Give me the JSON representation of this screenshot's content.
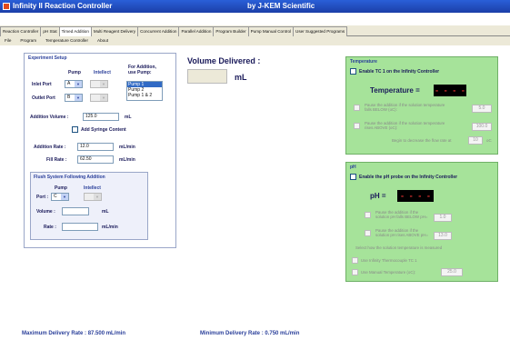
{
  "window": {
    "title": "Infinity II Reaction Controller",
    "vendor": "by J-KEM Scientific"
  },
  "tabs": [
    {
      "label": "Reaction Controller"
    },
    {
      "label": "pH Stat"
    },
    {
      "label": "Timed Addition"
    },
    {
      "label": "Multi Reagent Delivery"
    },
    {
      "label": "Concurrent Addition"
    },
    {
      "label": "Parallel Addition"
    },
    {
      "label": "Program Builder"
    },
    {
      "label": "Pump Manual Control"
    },
    {
      "label": "User Suggested Programs"
    }
  ],
  "active_tab": "Timed Addition",
  "menu": [
    "File",
    "Program",
    "Temperature Controller",
    "About"
  ],
  "experiment": {
    "title": "Experiment Setup",
    "col_pump": "Pump",
    "col_intellect": "Intellect",
    "for_addition_label": "For Addition,\nuse Pump:",
    "inlet_label": "Inlet Port",
    "inlet_value": "A",
    "outlet_label": "Outlet Port",
    "outlet_value": "B",
    "pump_options": [
      "Pump 1",
      "Pump 2",
      "Pump 1 & 2"
    ],
    "addition_volume_label": "Addition Volume :",
    "addition_volume_value": "125.0",
    "addition_volume_unit": "mL",
    "syringe_content_label": "Add Syringe Content",
    "addition_rate_label": "Addition Rate :",
    "addition_rate_value": "12.0",
    "addition_rate_unit": "mL/min",
    "fill_rate_label": "Fill Rate :",
    "fill_rate_value": "62.50",
    "fill_rate_unit": "mL/min"
  },
  "flush": {
    "title": "Flush System Following Addition",
    "col_pump": "Pump",
    "col_intellect": "Intellect",
    "port_label": "Port :",
    "port_value": "C",
    "volume_label": "Volume :",
    "volume_unit": "mL",
    "rate_label": "Rate :",
    "rate_unit": "mL/min"
  },
  "volume_delivered": {
    "label": "Volume Delivered :",
    "unit": "mL"
  },
  "temperature": {
    "title": "Temperature",
    "enable_label": "Enable TC 1 on the Infinity Controller",
    "reading_label": "Temperature =",
    "reading_value": "- - - -",
    "pause_below_label": "Pause the addition if the solution temperature falls BELOW (oC):",
    "pause_below_value": "5.0",
    "pause_above_label": "Pause the addition if the solution temperature rises ABOVE (oC):",
    "pause_above_value": "100.0",
    "flow_rate_label": "Begin to decrease the flow rate at",
    "flow_rate_value": "10",
    "flow_rate_unit": "oC"
  },
  "ph": {
    "title": "pH",
    "enable_label": "Enable the pH probe on the Infinity Controller",
    "reading_label": "pH =",
    "reading_value": "- - - -",
    "pause_below_label": "Pause the addition if the solution pH falls BELOW pH=",
    "pause_below_value": "1.0",
    "pause_above_label": "Pause the addition if the solution pH rises ABOVE pH=",
    "pause_above_value": "13.0",
    "select_temp_label": "Select how the solution temperature is measured",
    "thermocouple_label": "Use Infinity Thermocouple TC 1",
    "manual_temp_label": "Use Manual Temperature (oC):",
    "manual_temp_value": "25.0"
  },
  "footer": {
    "max_rate": "Maximum Delivery Rate : 87.500 mL/min",
    "min_rate": "Minimum Delivery Rate : 0.750 mL/min"
  },
  "colors": {
    "titlebar": "#2a5fd8",
    "green_panel": "#a6e39a",
    "display_bg": "#000000",
    "display_text": "#e23030"
  }
}
